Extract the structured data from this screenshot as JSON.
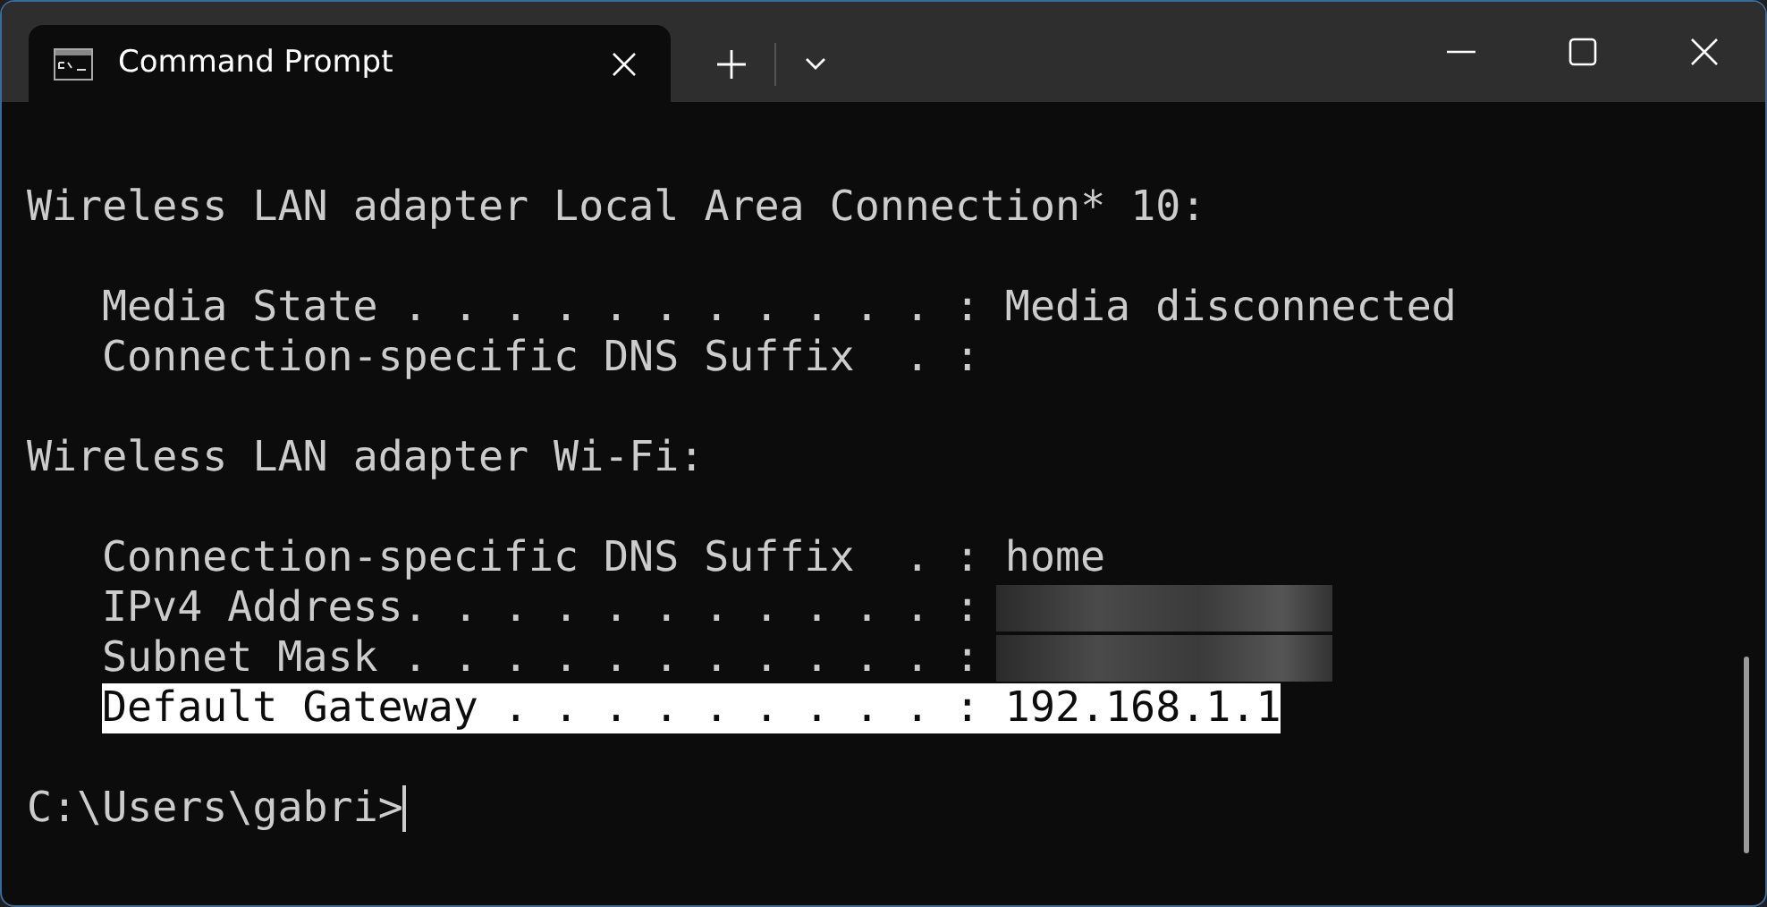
{
  "tab": {
    "title": "Command Prompt",
    "selected": true
  },
  "lines": [
    {
      "kind": "heading",
      "text": "Wireless LAN adapter Local Area Connection* 10:",
      "selected": false
    },
    {
      "kind": "blank"
    },
    {
      "kind": "entry",
      "text": "Media State . . . . . . . . . . . : Media disconnected",
      "selected": false
    },
    {
      "kind": "entry",
      "text": "Connection-specific DNS Suffix  . :",
      "selected": false
    },
    {
      "kind": "blank"
    },
    {
      "kind": "heading",
      "text": "Wireless LAN adapter Wi-Fi:",
      "selected": false
    },
    {
      "kind": "blank"
    },
    {
      "kind": "entry",
      "text": "Connection-specific DNS Suffix  . : home",
      "selected": false
    },
    {
      "kind": "entry",
      "text": "IPv4 Address. . . . . . . . . . . :",
      "selected": false,
      "redacted": true
    },
    {
      "kind": "entry",
      "text": "Subnet Mask . . . . . . . . . . . :",
      "selected": false,
      "redacted": true
    },
    {
      "kind": "entry",
      "text": "Default Gateway . . . . . . . . . : 192.168.1.1",
      "selected": true
    },
    {
      "kind": "blank"
    },
    {
      "kind": "prompt",
      "text": "C:\\Users\\gabri>",
      "selected": false
    }
  ]
}
